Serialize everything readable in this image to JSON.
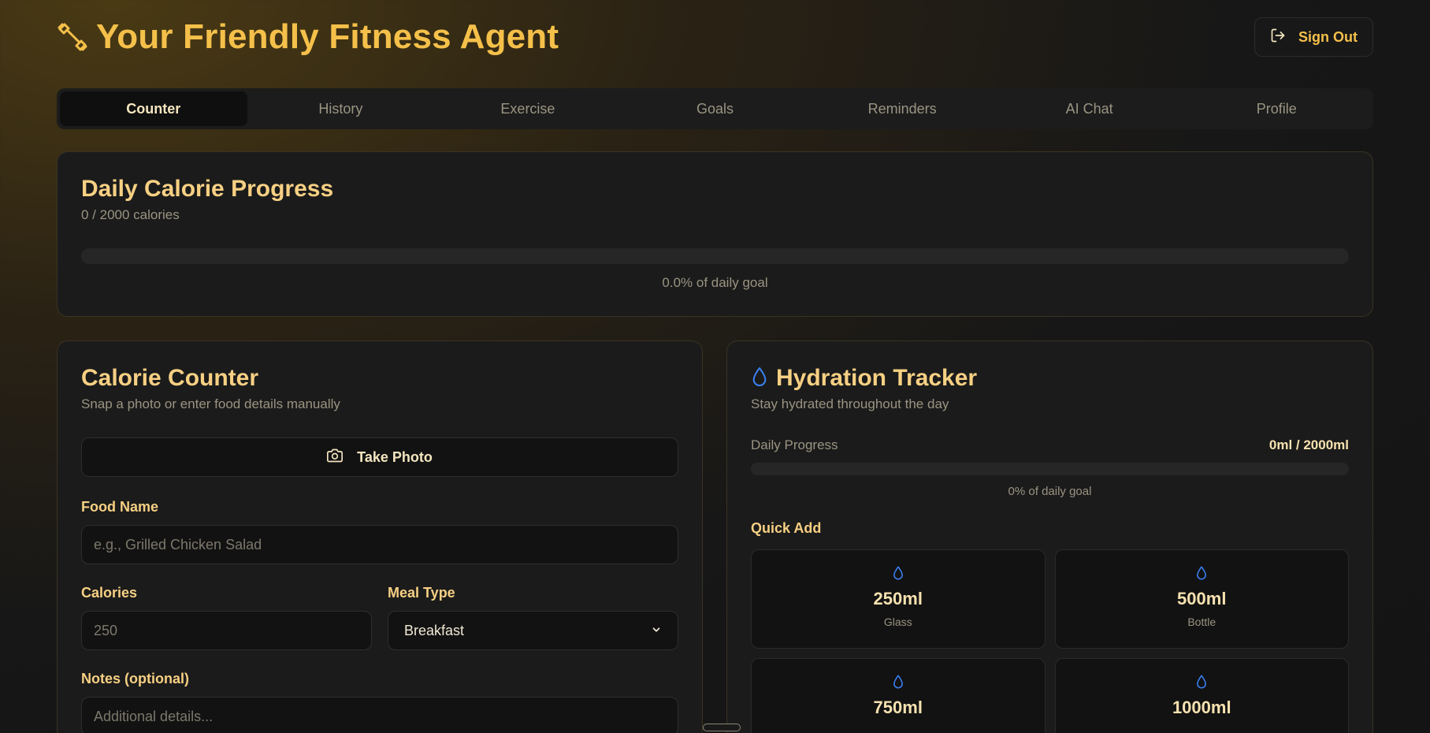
{
  "header": {
    "title": "Your Friendly Fitness Agent",
    "brand_icon": "dumbbell-icon",
    "sign_out_label": "Sign Out",
    "sign_out_icon": "log-out-icon"
  },
  "tabs": [
    {
      "label": "Counter",
      "active": true
    },
    {
      "label": "History",
      "active": false
    },
    {
      "label": "Exercise",
      "active": false
    },
    {
      "label": "Goals",
      "active": false
    },
    {
      "label": "Reminders",
      "active": false
    },
    {
      "label": "AI Chat",
      "active": false
    },
    {
      "label": "Profile",
      "active": false
    }
  ],
  "daily_progress": {
    "title": "Daily Calorie Progress",
    "subtitle": "0 / 2000 calories",
    "percent": 0,
    "caption": "0.0% of daily goal"
  },
  "calorie_counter": {
    "title": "Calorie Counter",
    "subtitle": "Snap a photo or enter food details manually",
    "photo_button": "Take Photo",
    "photo_icon": "camera-icon",
    "food_name_label": "Food Name",
    "food_name_placeholder": "e.g., Grilled Chicken Salad",
    "food_name_value": "",
    "calories_label": "Calories",
    "calories_placeholder": "250",
    "calories_value": "",
    "meal_type_label": "Meal Type",
    "meal_type_value": "Breakfast",
    "notes_label": "Notes (optional)",
    "notes_placeholder": "Additional details...",
    "notes_value": ""
  },
  "hydration": {
    "title": "Hydration Tracker",
    "title_icon": "droplet-icon",
    "subtitle": "Stay hydrated throughout the day",
    "progress_label": "Daily Progress",
    "progress_value": "0ml / 2000ml",
    "percent": 0,
    "caption": "0% of daily goal",
    "quick_add_label": "Quick Add",
    "quick_add": [
      {
        "amount": "250ml",
        "name": "Glass"
      },
      {
        "amount": "500ml",
        "name": "Bottle"
      },
      {
        "amount": "750ml",
        "name": ""
      },
      {
        "amount": "1000ml",
        "name": ""
      }
    ]
  },
  "colors": {
    "accent": "#f5c04a",
    "water": "#3b82f6",
    "card_bg": "#1b1b1b",
    "page_bg": "#151515"
  }
}
